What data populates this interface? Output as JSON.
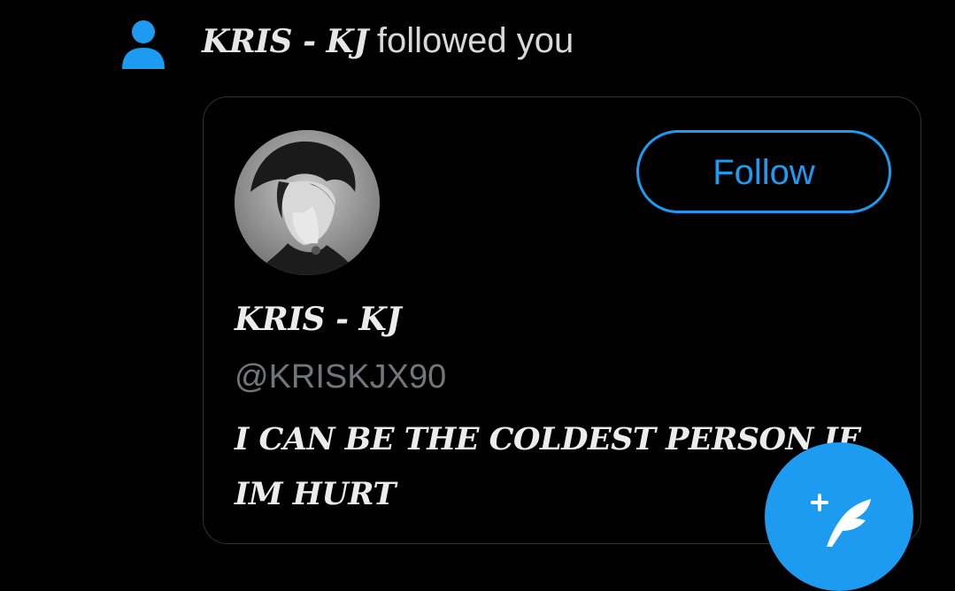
{
  "notification": {
    "icon": "person-icon",
    "name": "KRIS - KJ",
    "text": "followed you"
  },
  "card": {
    "avatar": "profile-photo",
    "follow_label": "Follow",
    "display_name": "KRIS - KJ",
    "handle": "@KRISKJX90",
    "bio": "I CAN BE THE COLDEST PERSON IF IM HURT"
  },
  "fab": {
    "icon": "compose-feather-icon"
  },
  "colors": {
    "accent": "#1d9bf0",
    "background": "#000000",
    "border": "#2f3336",
    "secondary_text": "#71767b"
  }
}
